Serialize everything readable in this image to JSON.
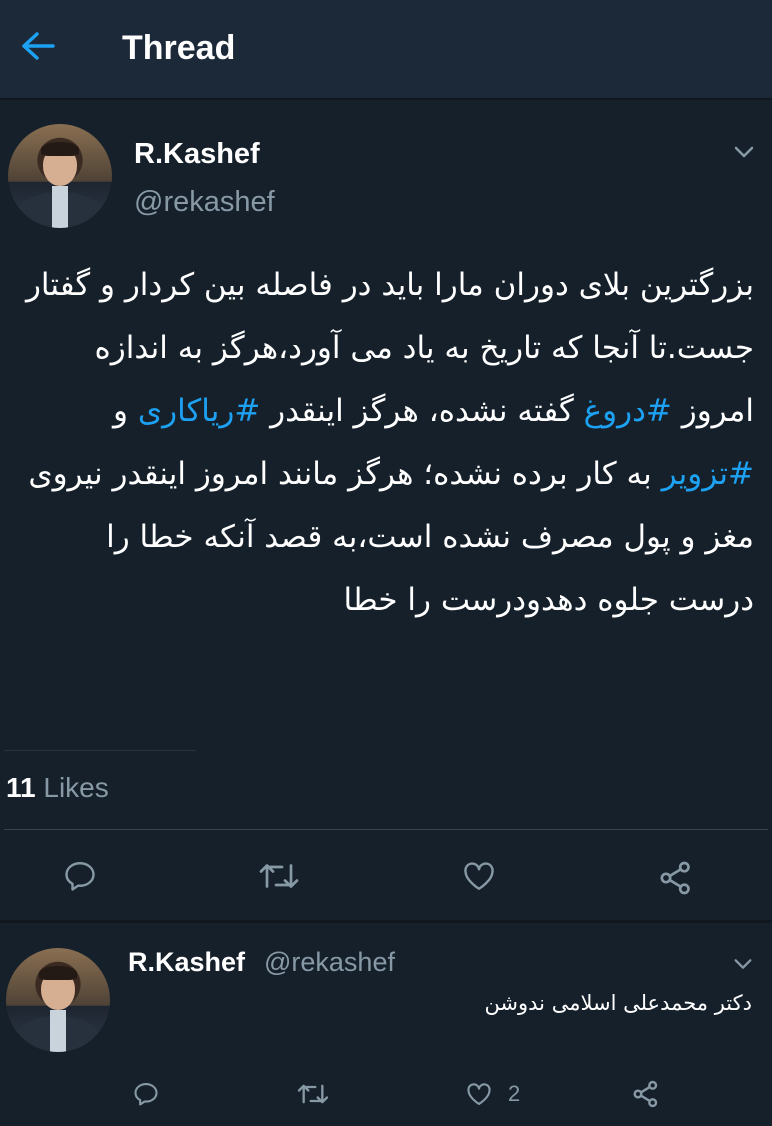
{
  "header": {
    "title": "Thread",
    "back_icon": "arrow-left-icon",
    "accent_color": "#1da1f2"
  },
  "main_tweet": {
    "author_name": "R.Kashef",
    "author_handle": "@rekashef",
    "text_parts": {
      "p1": "بزرگترین بلای دوران مارا باید در فاصله بین کردار و گفتار جست.تا آنجا که تاریخ به یاد می آورد،هرگز به اندازه امروز ",
      "tag1": "#دروغ",
      "p2": " گفته نشده، هرگز اینقدر ",
      "tag2": "#ریاکاری",
      "p3": " و ",
      "tag3": "#تزویر",
      "p4": " به کار برده نشده؛ هرگز مانند امروز اینقدر نیروی مغز و پول مصرف نشده است،به قصد آنکه خطا را درست جلوه دهدودرست را خطا"
    },
    "likes_count": "11",
    "likes_label": "Likes",
    "actions": [
      "reply-icon",
      "retweet-icon",
      "like-icon",
      "share-icon"
    ]
  },
  "reply_tweet": {
    "author_name": "R.Kashef",
    "author_handle": "@rekashef",
    "text": "دکتر محمدعلی اسلامی ندوشن",
    "like_count": "2",
    "actions": [
      "reply-icon",
      "retweet-icon",
      "like-icon",
      "share-icon"
    ]
  }
}
